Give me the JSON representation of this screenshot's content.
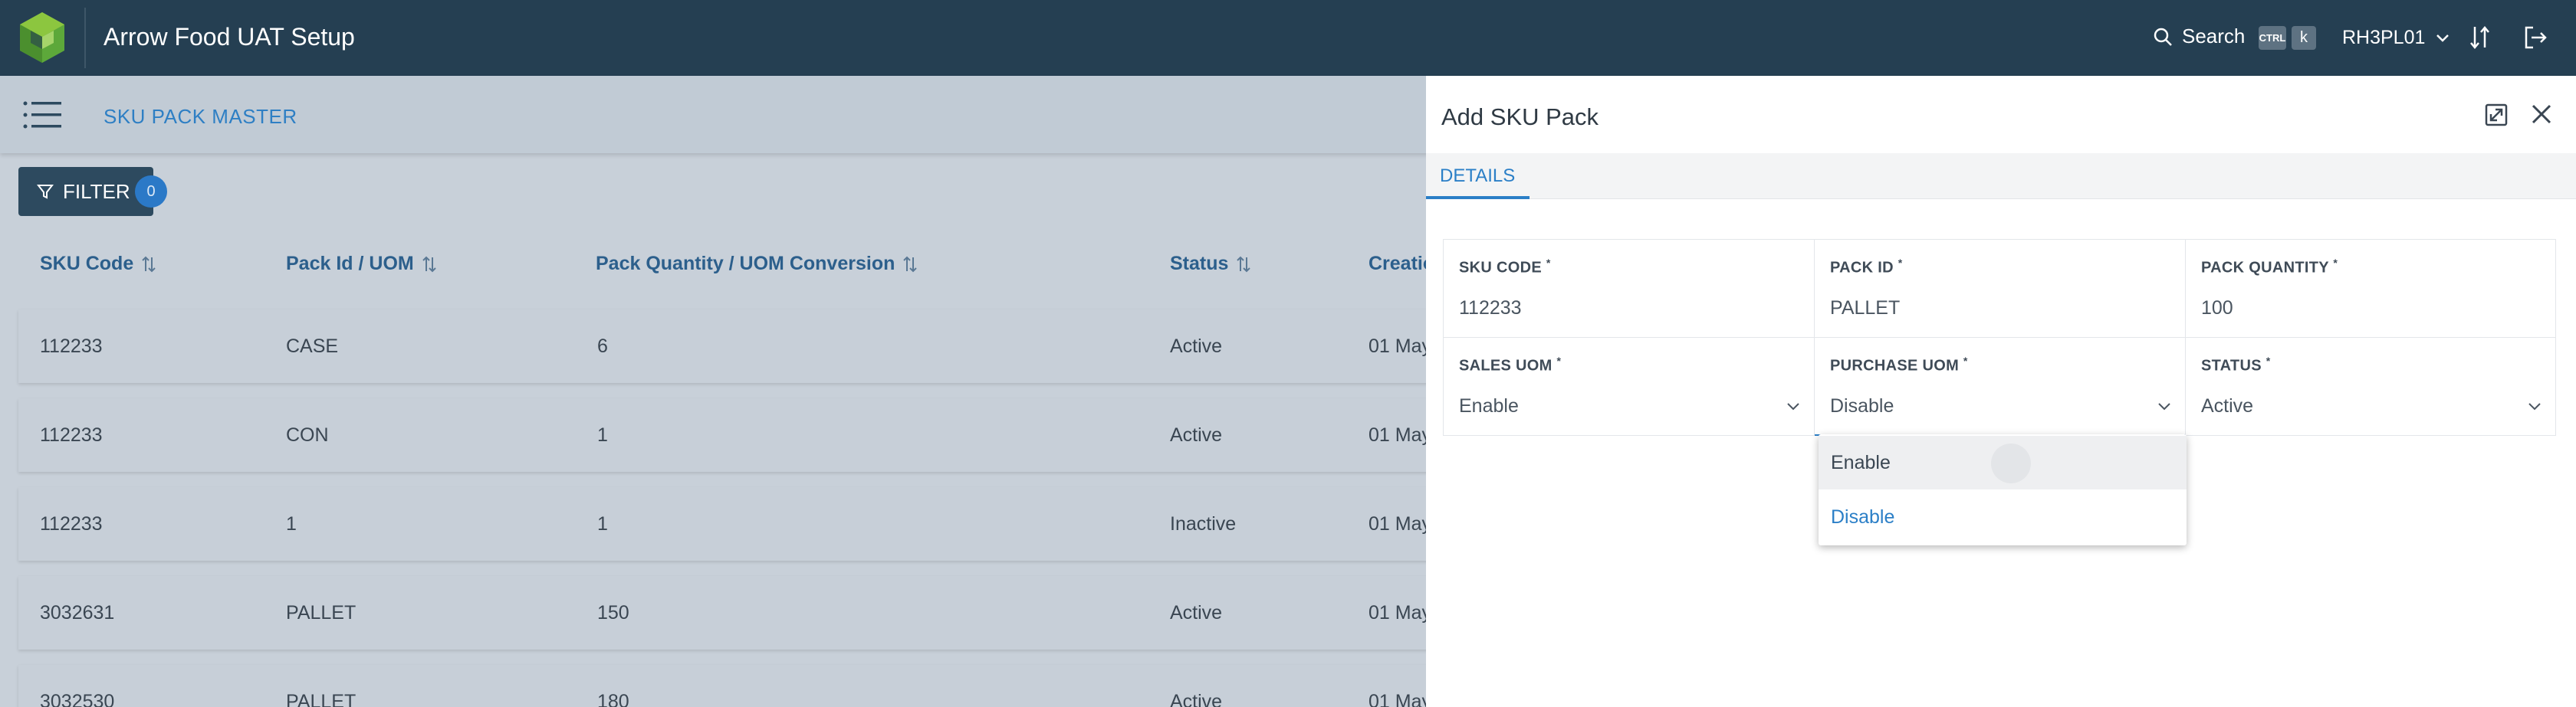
{
  "app": {
    "title": "Arrow Food UAT Setup"
  },
  "topbar": {
    "search_label": "Search",
    "kbd_ctrl": "CTRL",
    "kbd_k": "k",
    "user": "RH3PL01",
    "icons": [
      "logo-icon",
      "search-icon",
      "chevron-down-icon",
      "sort-icon",
      "logout-icon"
    ]
  },
  "subheader": {
    "page_title": "SKU PACK MASTER"
  },
  "filter": {
    "label": "FILTER",
    "count": "0"
  },
  "table": {
    "headers": [
      "SKU Code",
      "Pack Id / UOM",
      "Pack Quantity / UOM Conversion",
      "Status",
      "Creatio"
    ],
    "rows": [
      {
        "sku": "112233",
        "pack": "CASE",
        "qty": "6",
        "status": "Active",
        "created": "01 May"
      },
      {
        "sku": "112233",
        "pack": "CON",
        "qty": "1",
        "status": "Active",
        "created": "01 May"
      },
      {
        "sku": "112233",
        "pack": "1",
        "qty": "1",
        "status": "Inactive",
        "created": "01 May"
      },
      {
        "sku": "3032631",
        "pack": "PALLET",
        "qty": "150",
        "status": "Active",
        "created": "01 May"
      },
      {
        "sku": "3032530",
        "pack": "PALLET",
        "qty": "180",
        "status": "Active",
        "created": "01 May"
      }
    ]
  },
  "panel": {
    "title": "Add SKU Pack",
    "tab": "DETAILS",
    "fields": {
      "sku_code": {
        "label": "SKU CODE",
        "value": "112233"
      },
      "pack_id": {
        "label": "PACK ID",
        "value": "PALLET"
      },
      "pack_qty": {
        "label": "PACK QUANTITY",
        "value": "100"
      },
      "sales_uom": {
        "label": "SALES UOM",
        "value": "Enable"
      },
      "purchase_uom": {
        "label": "PURCHASE UOM",
        "value": "Disable"
      },
      "status": {
        "label": "STATUS",
        "value": "Active"
      }
    },
    "dropdown": {
      "options": [
        "Enable",
        "Disable"
      ],
      "selected": "Disable"
    }
  },
  "colors": {
    "topbar": "#253f52",
    "accent": "#2b7fc7",
    "logo_green": "#7ac143"
  }
}
